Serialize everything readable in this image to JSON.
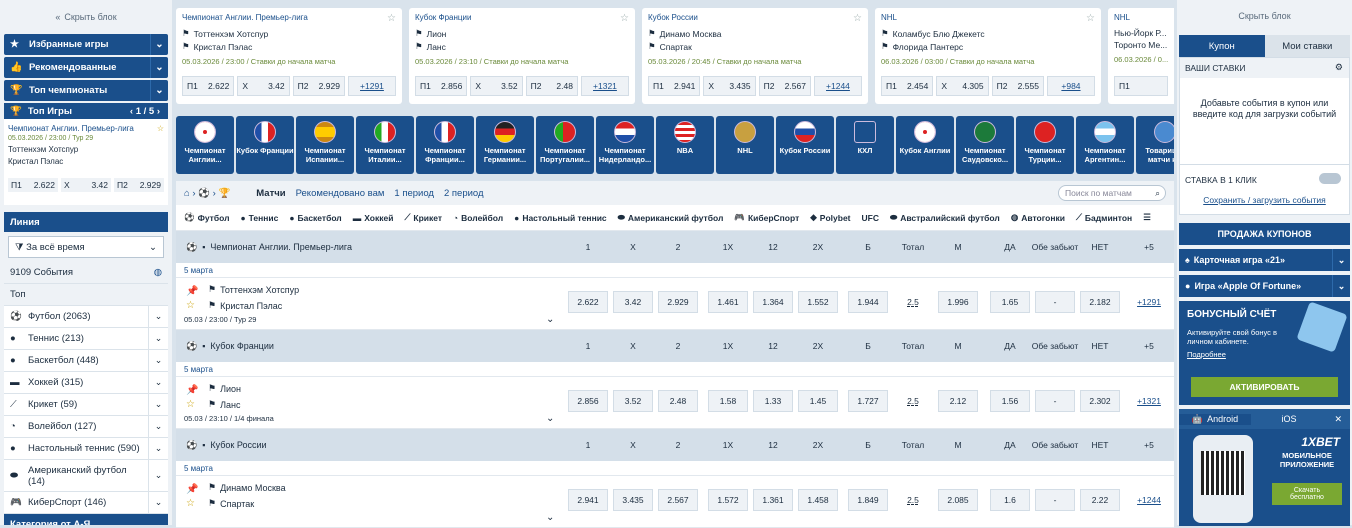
{
  "left": {
    "hide": "Скрыть блок",
    "nav": [
      "Избранные игры",
      "Рекомендованные",
      "Топ чемпионаты"
    ],
    "top_games": {
      "title": "Топ Игры",
      "page": "1 / 5",
      "league": "Чемпионат Англии. Премьер-лига",
      "datetime": "05.03.2026 / 23:00 / Тур 29",
      "team1": "Тоттенхэм Хотспур",
      "team2": "Кристал Пэлас",
      "odds": [
        [
          "П1",
          "2.622"
        ],
        [
          "Х",
          "3.42"
        ],
        [
          "П2",
          "2.929"
        ]
      ]
    },
    "line": "Линия",
    "period": "За всё время",
    "events": "9109 События",
    "top": "Топ",
    "sports": [
      "Футбол (2063)",
      "Теннис (213)",
      "Баскетбол (448)",
      "Хоккей (315)",
      "Крикет (59)",
      "Волейбол (127)",
      "Настольный теннис (590)",
      "Американский футбол (14)",
      "КиберСпорт (146)"
    ],
    "category": "Категория от А-Я"
  },
  "cards": [
    {
      "league": "Чемпионат Англии. Премьер-лига",
      "t1": "Тоттенхэм Хотспур",
      "t2": "Кристал Пэлас",
      "dt": "05.03.2026 / 23:00 / Ставки до начала матча",
      "o": [
        [
          "П1",
          "2.622"
        ],
        [
          "Х",
          "3.42"
        ],
        [
          "П2",
          "2.929"
        ]
      ],
      "more": "+1291"
    },
    {
      "league": "Кубок Франции",
      "t1": "Лион",
      "t2": "Ланс",
      "dt": "05.03.2026 / 23:10 / Ставки до начала матча",
      "o": [
        [
          "П1",
          "2.856"
        ],
        [
          "Х",
          "3.52"
        ],
        [
          "П2",
          "2.48"
        ]
      ],
      "more": "+1321"
    },
    {
      "league": "Кубок России",
      "t1": "Динамо Москва",
      "t2": "Спартак",
      "dt": "05.03.2026 / 20:45 / Ставки до начала матча",
      "o": [
        [
          "П1",
          "2.941"
        ],
        [
          "Х",
          "3.435"
        ],
        [
          "П2",
          "2.567"
        ]
      ],
      "more": "+1244"
    },
    {
      "league": "NHL",
      "t1": "Коламбус Блю Джекетс",
      "t2": "Флорида Пантерс",
      "dt": "06.03.2026 / 03:00 / Ставки до начала матча",
      "o": [
        [
          "П1",
          "2.454"
        ],
        [
          "Х",
          "4.305"
        ],
        [
          "П2",
          "2.555"
        ]
      ],
      "more": "+984"
    },
    {
      "league": "NHL",
      "t1": "Нью-Йорк Р...",
      "t2": "Торонто Ме...",
      "dt": "06.03.2026 / 0...",
      "o": [
        [
          "П1",
          ""
        ]
      ],
      "more": ""
    }
  ],
  "strip": [
    "Чемпионат Англии...",
    "Кубок Франции",
    "Чемпионат Испании...",
    "Чемпионат Италии...",
    "Чемпионат Франции...",
    "Чемпионат Германии...",
    "Чемпионат Португалии...",
    "Чемпионат Нидерландо...",
    "NBA",
    "NHL",
    "Кубок России",
    "КХЛ",
    "Кубок Англии",
    "Чемпионат Саудовско...",
    "Чемпионат Турции...",
    "Чемпионат Аргентин...",
    "Товарищ... матчи к..."
  ],
  "main": {
    "tabs": [
      "Матчи",
      "Рекомендовано вам",
      "1 период",
      "2 период"
    ],
    "search": "Поиск по матчам",
    "sports": [
      "Футбол",
      "Теннис",
      "Баскетбол",
      "Хоккей",
      "Крикет",
      "Волейбол",
      "Настольный теннис",
      "Американский футбол",
      "КиберСпорт",
      "Polybet",
      "UFC",
      "Австралийский футбол",
      "Автогонки",
      "Бадминтон"
    ],
    "cols": [
      "1",
      "X",
      "2",
      "1X",
      "12",
      "2X",
      "Б",
      "Тотал",
      "М",
      "ДА",
      "Обе забьют",
      "НЕТ",
      "+5"
    ],
    "leagues": [
      {
        "name": "Чемпионат Англии. Премьер-лига",
        "date": "5 марта",
        "t1": "Тоттенхэм Хотспур",
        "t2": "Кристал Пэлас",
        "dt": "05.03 / 23:00 / Тур 29",
        "odds": [
          "2.622",
          "3.42",
          "2.929",
          "1.461",
          "1.364",
          "1.552",
          "1.944",
          "2.5",
          "1.996",
          "1.65",
          "-",
          "2.182"
        ],
        "more": "+1291"
      },
      {
        "name": "Кубок Франции",
        "date": "5 марта",
        "t1": "Лион",
        "t2": "Ланс",
        "dt": "05.03 / 23:10 / 1/4 финала",
        "odds": [
          "2.856",
          "3.52",
          "2.48",
          "1.58",
          "1.33",
          "1.45",
          "1.727",
          "2.5",
          "2.12",
          "1.56",
          "-",
          "2.302"
        ],
        "more": "+1321"
      },
      {
        "name": "Кубок России",
        "date": "5 марта",
        "t1": "Динамо Москва",
        "t2": "Спартак",
        "dt": "",
        "odds": [
          "2.941",
          "3.435",
          "2.567",
          "1.572",
          "1.361",
          "1.458",
          "1.849",
          "2.5",
          "2.085",
          "1.6",
          "-",
          "2.22"
        ],
        "more": "+1244"
      }
    ]
  },
  "right": {
    "hide": "Скрыть блок",
    "tab1": "Купон",
    "tab2": "Мои ставки",
    "my_bets": "ВАШИ СТАВКИ",
    "empty": "Добавьте события в купон или введите код для загрузки событий",
    "one_click": "СТАВКА В 1 КЛИК",
    "save": "Сохранить / загрузить события",
    "sale": "ПРОДАЖА КУПОНОВ",
    "card_game": "Карточная игра «21»",
    "apple": "Игра «Apple Of Fortune»",
    "bonus_title": "БОНУСНЫЙ СЧЁТ",
    "bonus_text": "Активируйте свой бонус в личном кабинете.",
    "more": "Подробнее",
    "activate": "АКТИВИРОВАТЬ",
    "android": "Android",
    "ios": "iOS",
    "brand": "1XBET",
    "mobile": "МОБИЛЬНОЕ ПРИЛОЖЕНИЕ",
    "download": "Скачать бесплатно"
  }
}
